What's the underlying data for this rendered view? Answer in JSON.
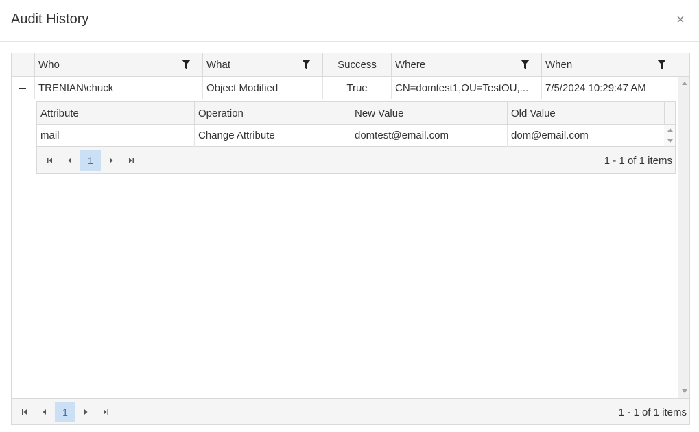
{
  "dialog": {
    "title": "Audit History",
    "close_label": "×"
  },
  "grid": {
    "columns": [
      {
        "label": "Who"
      },
      {
        "label": "What"
      },
      {
        "label": "Success"
      },
      {
        "label": "Where"
      },
      {
        "label": "When"
      }
    ],
    "rows": [
      {
        "who": "TRENIAN\\chuck",
        "what": "Object Modified",
        "success": "True",
        "where": "CN=domtest1,OU=TestOU,...",
        "when": "7/5/2024 10:29:47 AM"
      }
    ],
    "detail": {
      "columns": [
        {
          "label": "Attribute"
        },
        {
          "label": "Operation"
        },
        {
          "label": "New Value"
        },
        {
          "label": "Old Value"
        }
      ],
      "rows": [
        {
          "attribute": "mail",
          "operation": "Change Attribute",
          "new_value": "domtest@email.com",
          "old_value": "dom@email.com"
        }
      ],
      "pager": {
        "page": "1",
        "info": "1 - 1 of 1 items"
      }
    },
    "pager": {
      "page": "1",
      "info": "1 - 1 of 1 items"
    }
  }
}
